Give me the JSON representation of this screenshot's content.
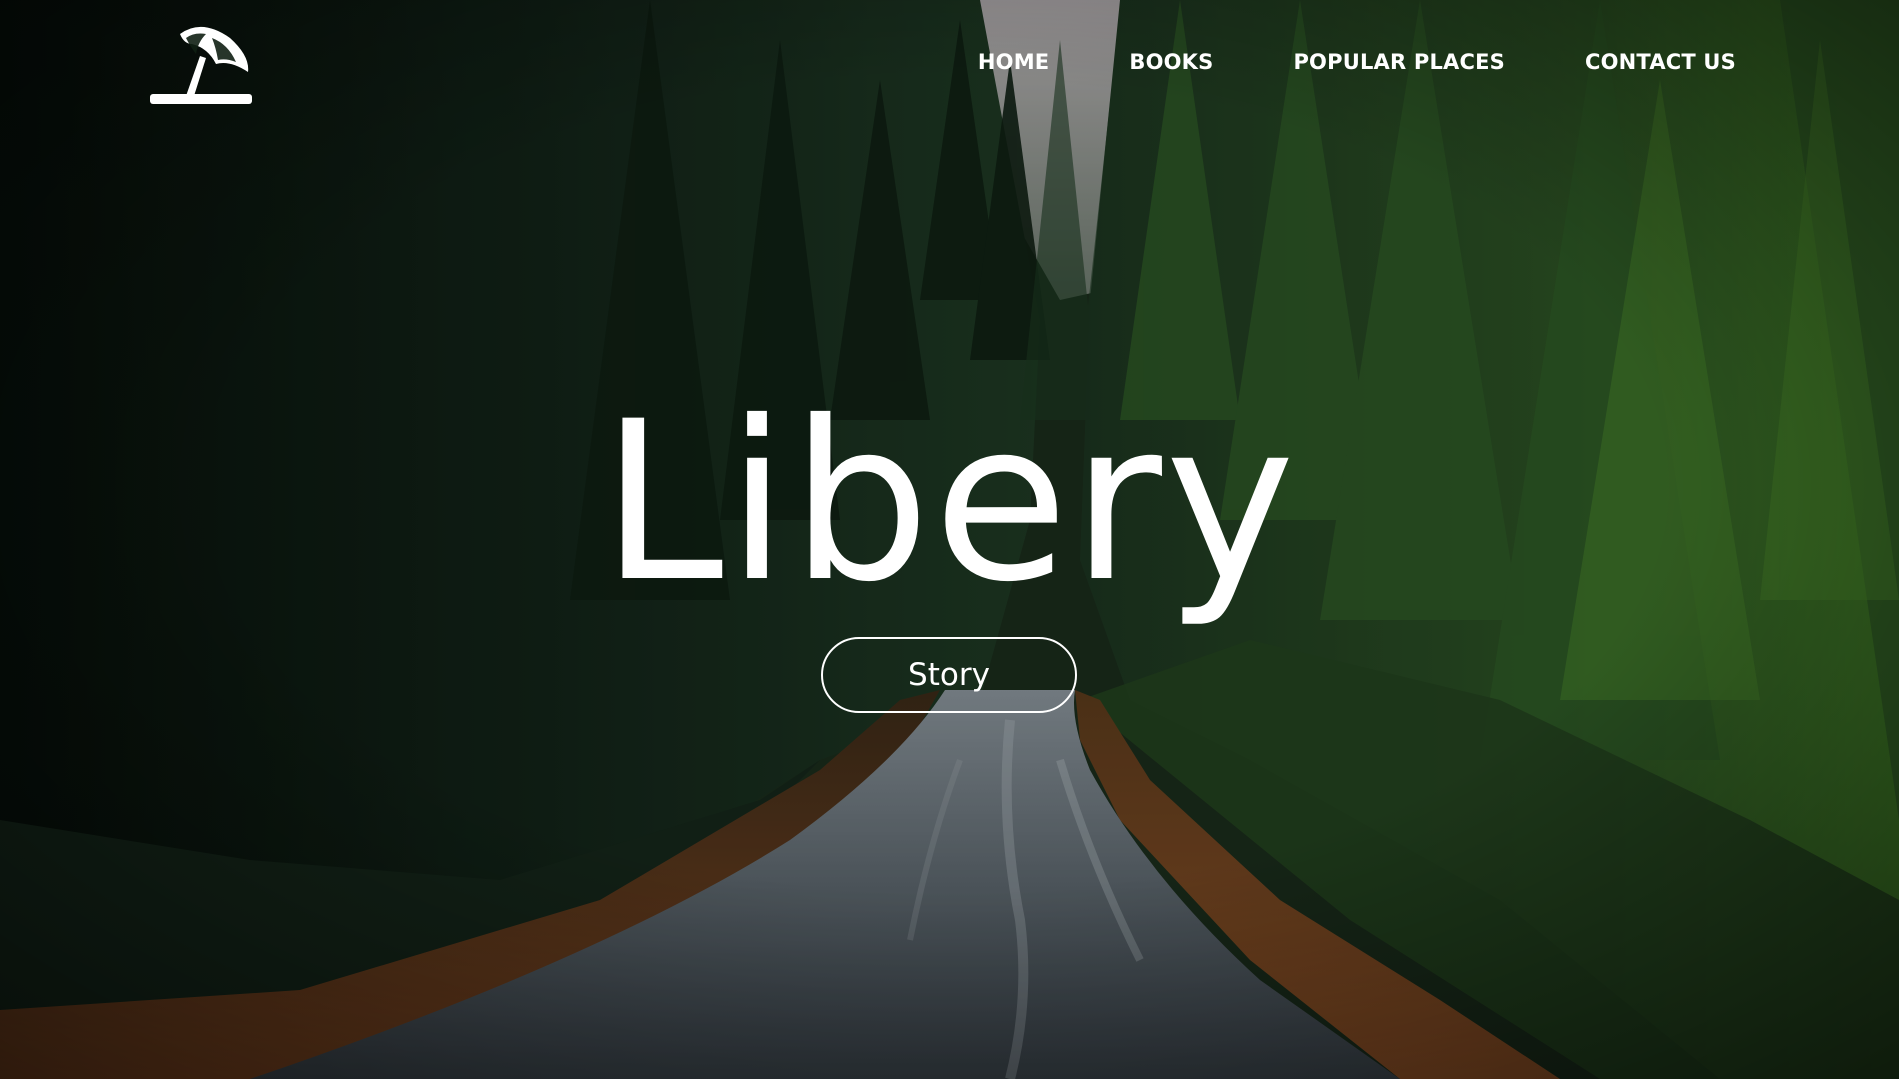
{
  "brand": {
    "logo_icon": "beach-umbrella-icon"
  },
  "nav": {
    "items": [
      {
        "label": "HOME"
      },
      {
        "label": "BOOKS"
      },
      {
        "label": "POPULAR PLACES"
      },
      {
        "label": "CONTACT US"
      }
    ]
  },
  "hero": {
    "title": "Libery",
    "cta_label": "Story",
    "background": "forest-road-photo"
  },
  "colors": {
    "text": "#ffffff",
    "forest_dark": "#0d1a10",
    "forest_mid": "#2b4a23",
    "road": "#5a6670",
    "dirt": "#8a4e24"
  }
}
